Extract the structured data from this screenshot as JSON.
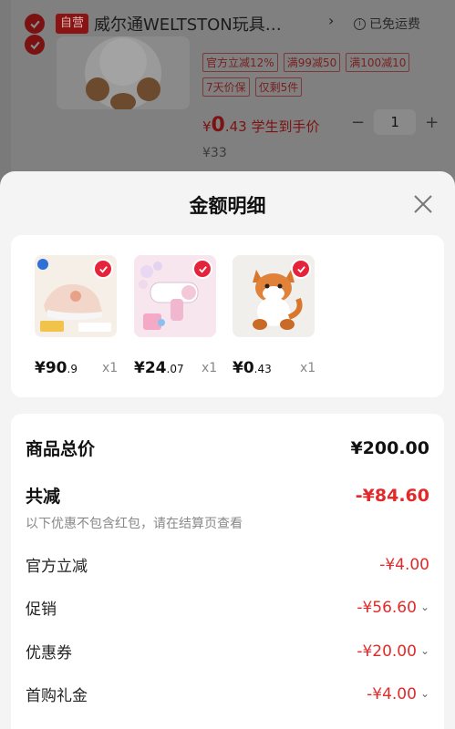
{
  "cart": {
    "self_tag": "自营",
    "shop_name": "威尔通WELTSTON玩具…",
    "shop_arrow": "›",
    "free_shipping": "已免运费",
    "tags": [
      "官方立减12%",
      "满99减50",
      "满100减10",
      "7天价保",
      "仅剩5件"
    ],
    "price_prefix": "¥",
    "price_int": "0",
    "price_dec": ".43",
    "price_suffix": "学生到手价",
    "quantity": "1",
    "minus": "−",
    "plus": "+",
    "original_price": "¥33"
  },
  "sheet": {
    "title": "金额明细",
    "products": [
      {
        "price_int": "¥90",
        "price_dec": ".9",
        "qty": "x1",
        "image": "kids-shoes"
      },
      {
        "price_int": "¥24",
        "price_dec": ".07",
        "qty": "x1",
        "image": "bubble-gun"
      },
      {
        "price_int": "¥0",
        "price_dec": ".43",
        "qty": "x1",
        "image": "fox-plush"
      }
    ],
    "total_label": "商品总价",
    "total_value": "¥200.00",
    "discount_label": "共减",
    "discount_value": "-¥84.60",
    "note": "以下优惠不包含红包，请在结算页查看",
    "items": [
      {
        "label": "官方立减",
        "value": "-¥4.00",
        "expandable": false
      },
      {
        "label": "促销",
        "value": "-¥56.60",
        "expandable": true
      },
      {
        "label": "优惠券",
        "value": "-¥20.00",
        "expandable": true
      },
      {
        "label": "首购礼金",
        "value": "-¥4.00",
        "expandable": true
      }
    ]
  },
  "colors": {
    "accent": "#e22a2a",
    "check": "#e5243b"
  }
}
